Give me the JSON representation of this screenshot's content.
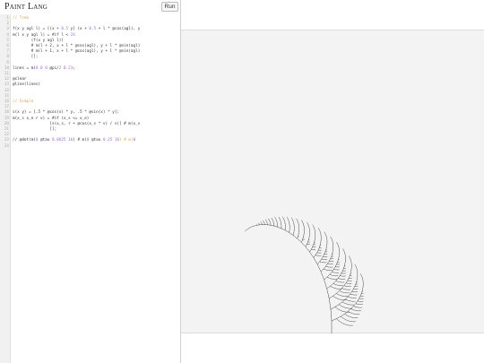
{
  "app": {
    "title": "Paint Lang",
    "run_label": "Run"
  },
  "editor": {
    "lines": [
      {
        "n": "1",
        "segs": [
          {
            "t": "// Tree",
            "c": "cm"
          }
        ]
      },
      {
        "n": "2",
        "segs": []
      },
      {
        "n": "3",
        "segs": [
          {
            "t": "f(x y agl l) = [(x + "
          },
          {
            "t": "0.5",
            "c": "num"
          },
          {
            "t": " y] (x + "
          },
          {
            "t": "0.5",
            "c": "num"
          },
          {
            "t": " + l * @cos(agl), y"
          }
        ]
      },
      {
        "n": "4",
        "segs": [
          {
            "t": "m(l x y agl l) = #if l < "
          },
          {
            "t": "24",
            "c": "num"
          }
        ]
      },
      {
        "n": "5",
        "segs": [
          {
            "t": "        (f(x y agl l))"
          }
        ]
      },
      {
        "n": "6",
        "segs": [
          {
            "t": "        # m(l + 2, x + l * @cos(agl), y + l * @sin(agl)"
          }
        ]
      },
      {
        "n": "7",
        "segs": [
          {
            "t": "        # m(l + 1, x + l * @cos(agl), y + l * @sin(agl)"
          }
        ]
      },
      {
        "n": "8",
        "segs": [
          {
            "t": "        [];"
          }
        ]
      },
      {
        "n": "9",
        "segs": []
      },
      {
        "n": "10",
        "segs": [
          {
            "t": "lines = m("
          },
          {
            "t": "0 0 0",
            "c": "num"
          },
          {
            "t": " @pi/"
          },
          {
            "t": "2 0.2",
            "c": "num"
          },
          {
            "t": ");"
          }
        ]
      },
      {
        "n": "11",
        "segs": []
      },
      {
        "n": "12",
        "segs": [
          {
            "t": "@clear"
          }
        ]
      },
      {
        "n": "13",
        "segs": [
          {
            "t": "@line(lines)"
          }
        ]
      },
      {
        "n": "14",
        "segs": []
      },
      {
        "n": "15",
        "segs": []
      },
      {
        "n": "16",
        "segs": [
          {
            "t": "// Simple",
            "c": "cm"
          }
        ]
      },
      {
        "n": "17",
        "segs": []
      },
      {
        "n": "18",
        "segs": [
          {
            "t": "s(x y) = [.5 * @cos(x) * y, .5 * @sin(x) * y];"
          }
        ]
      },
      {
        "n": "19",
        "segs": [
          {
            "t": "m(x_s x_e r v) = #if (x_s <= x_e)"
          }
        ]
      },
      {
        "n": "20",
        "segs": [
          {
            "t": "                [s(x_s, r + @cos(x_s * v) / v)] # m(x_s"
          }
        ]
      },
      {
        "n": "21",
        "segs": [
          {
            "t": "                [];"
          }
        ]
      },
      {
        "n": "22",
        "segs": []
      },
      {
        "n": "23",
        "segs": [
          {
            "t": "// @dot(m("
          },
          {
            "t": "0",
            "c": "num"
          },
          {
            "t": " @tau "
          },
          {
            "t": "0.0625 16",
            "c": "num"
          },
          {
            "t": ") # m("
          },
          {
            "t": "0",
            "c": "num"
          },
          {
            "t": " @tau "
          },
          {
            "t": "0.25 16",
            "c": "num"
          },
          {
            "t": ") # m(",
            "c": "cm"
          },
          {
            "t": "0",
            "c": "num"
          }
        ]
      },
      {
        "n": "24",
        "segs": []
      }
    ]
  },
  "canvas": {
    "stroke_color": "#333333",
    "background": "#f3f3f3"
  }
}
